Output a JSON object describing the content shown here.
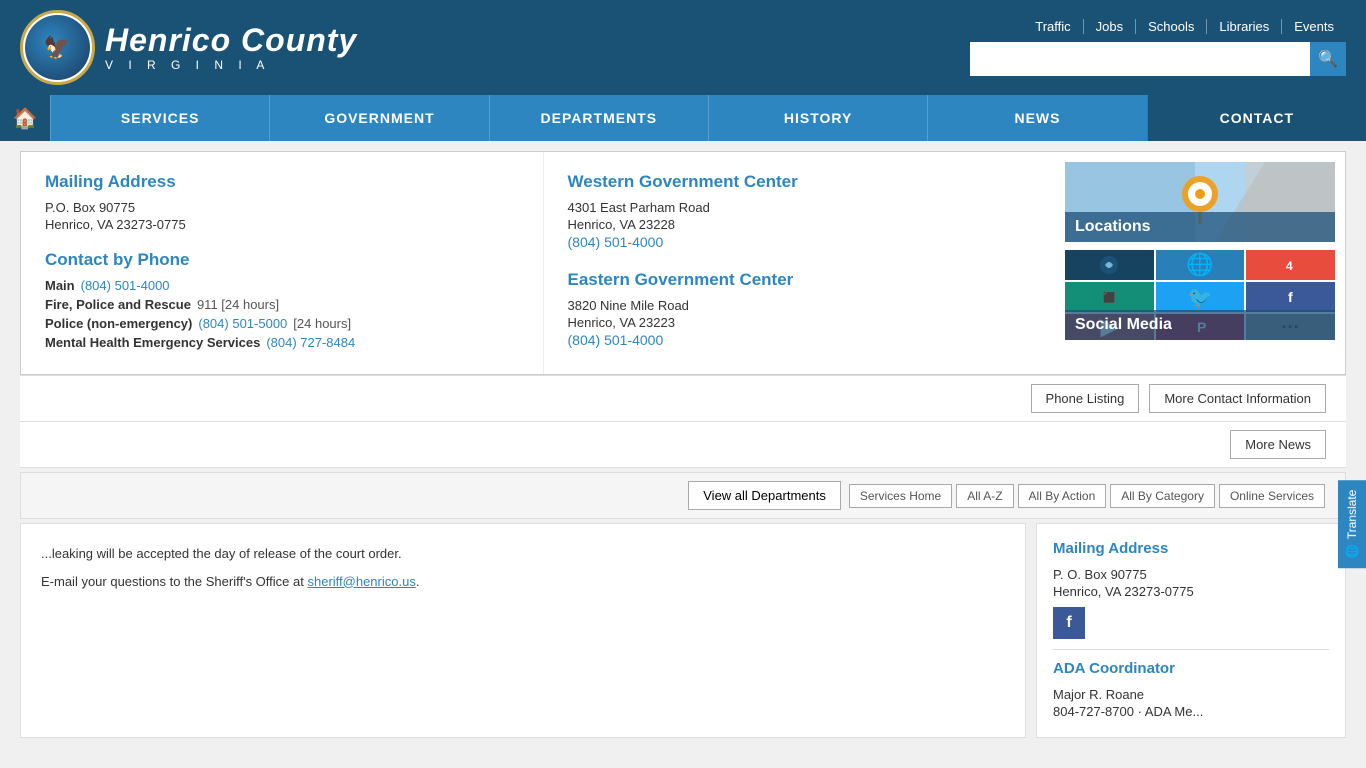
{
  "header": {
    "logo_text": "Henrico County",
    "logo_sub": "V I R G I N I A",
    "top_links": [
      "Traffic",
      "Jobs",
      "Schools",
      "Libraries",
      "Events"
    ],
    "search_placeholder": ""
  },
  "nav": {
    "home_label": "🏠",
    "items": [
      {
        "label": "SERVICES",
        "active": false
      },
      {
        "label": "GOVERNMENT",
        "active": false
      },
      {
        "label": "DEPARTMENTS",
        "active": false
      },
      {
        "label": "HISTORY",
        "active": false
      },
      {
        "label": "NEWS",
        "active": false
      },
      {
        "label": "CONTACT",
        "active": true
      }
    ]
  },
  "contact": {
    "mailing_title": "Mailing Address",
    "mailing_po": "P.O. Box 90775",
    "mailing_city": "Henrico, VA 23273-0775",
    "phone_title": "Contact by Phone",
    "phone_main_label": "Main",
    "phone_main": "(804) 501-4000",
    "phone_fire_label": "Fire, Police and Rescue",
    "phone_fire": "911 [24 hours]",
    "phone_police_label": "Police (non-emergency)",
    "phone_police": "(804) 501-5000",
    "phone_police_note": "[24 hours]",
    "phone_mental_label": "Mental Health Emergency Services",
    "phone_mental": "(804) 727-8484",
    "western_title": "Western Government Center",
    "western_addr1": "4301 East Parham Road",
    "western_addr2": "Henrico, VA 23228",
    "western_phone": "(804) 501-4000",
    "eastern_title": "Eastern Government Center",
    "eastern_addr1": "3820 Nine Mile Road",
    "eastern_addr2": "Henrico, VA 23223",
    "eastern_phone": "(804) 501-4000",
    "locations_label": "Locations",
    "social_media_label": "Social Media",
    "btn_phone_listing": "Phone Listing",
    "btn_more_contact": "More Contact Information",
    "btn_more_news": "More News",
    "btn_view_all_depts": "View all Departments",
    "btn_services_home": "Services Home",
    "btn_all_az": "All A-Z",
    "btn_all_by_action": "All By Action",
    "btn_all_by_category": "All By Category",
    "btn_online_services": "Online Services"
  },
  "sidebar": {
    "mailing_title": "Mailing Address",
    "mailing_po": "P. O. Box 90775",
    "mailing_city": "Henrico, VA 23273-0775",
    "ada_title": "ADA Coordinator",
    "ada_name": "Major R. Roane",
    "ada_note": "804-727-8700 · ADA Me..."
  },
  "page_content": {
    "text1": "...leaking will be accepted the day of release of the court order.",
    "text2": "E-mail your questions to the Sheriff's Office at",
    "email": "sheriff@henrico.us",
    "email_suffix": "."
  },
  "translate": {
    "label": "Translate"
  }
}
